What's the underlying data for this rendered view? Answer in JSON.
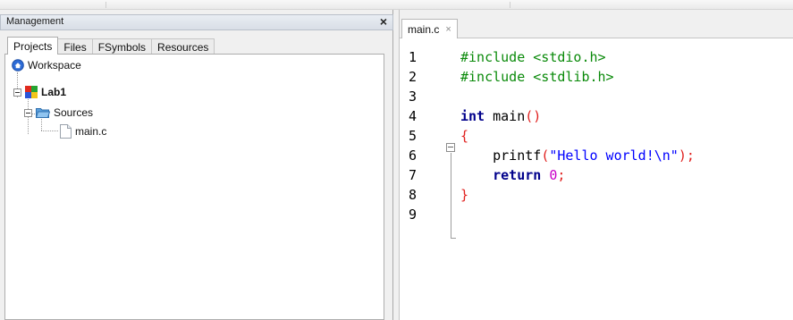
{
  "management": {
    "title": "Management",
    "close": "×",
    "tabs": [
      "Projects",
      "Files",
      "FSymbols",
      "Resources"
    ],
    "tree": {
      "workspace": "Workspace",
      "project": "Lab1",
      "folder": "Sources",
      "file": "main.c"
    }
  },
  "editor": {
    "tab_label": "main.c",
    "tab_close": "×",
    "line_numbers": [
      "1",
      "2",
      "3",
      "4",
      "5",
      "6",
      "7",
      "8",
      "9"
    ],
    "lines": {
      "l1": "#include <stdio.h>",
      "l2": "#include <stdlib.h>",
      "l4_kw": "int",
      "l4_rest": " main",
      "l4_paren": "()",
      "l5": "{",
      "l6_fn": "    printf",
      "l6_open": "(",
      "l6_str": "\"Hello world!\\n\"",
      "l6_close": ")",
      "l6_semi": ";",
      "l7_kw": "    return",
      "l7_sp": " ",
      "l7_num": "0",
      "l7_semi": ";",
      "l8": "}"
    }
  }
}
